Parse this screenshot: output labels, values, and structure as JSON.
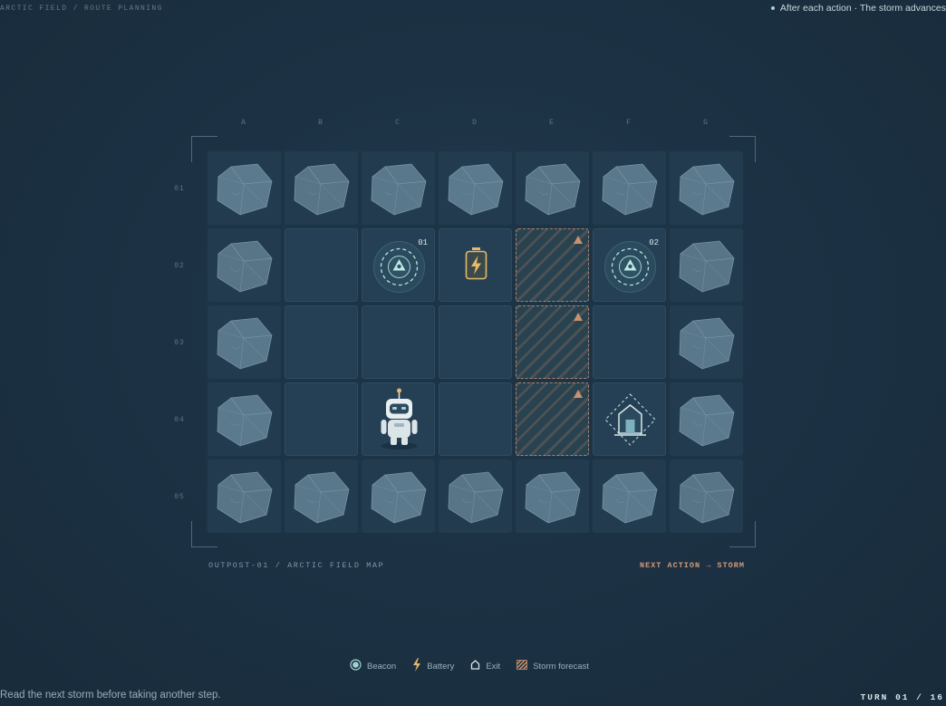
{
  "header": {
    "breadcrumb": "ARCTIC FIELD / ROUTE PLANNING",
    "status": "After each action · The storm advances"
  },
  "board": {
    "columns": [
      "A",
      "B",
      "C",
      "D",
      "E",
      "F",
      "G"
    ],
    "rows": [
      "01",
      "02",
      "03",
      "04",
      "05"
    ],
    "cells": [
      [
        "rock",
        "rock",
        "rock",
        "rock",
        "rock",
        "rock",
        "rock"
      ],
      [
        "rock",
        "empty",
        "beacon",
        "battery",
        "storm",
        "beacon",
        "rock"
      ],
      [
        "rock",
        "empty",
        "empty",
        "empty",
        "storm",
        "empty",
        "rock"
      ],
      [
        "rock",
        "empty",
        "robot",
        "empty",
        "storm",
        "exit",
        "rock"
      ],
      [
        "rock",
        "rock",
        "rock",
        "rock",
        "rock",
        "rock",
        "rock"
      ]
    ],
    "beacon_labels": {
      "C02": "01",
      "F02": "02"
    }
  },
  "captions": {
    "map_name": "OUTPOST-01 / ARCTIC FIELD MAP",
    "next_action": "NEXT ACTION → STORM"
  },
  "legend": {
    "beacon": "Beacon",
    "battery": "Battery",
    "exit": "Exit",
    "storm": "Storm forecast"
  },
  "footer": {
    "hint": "Read the next storm before taking another step.",
    "turn": "TURN 01 / 16"
  },
  "colors": {
    "accent_teal": "#9fd3d2",
    "storm_warning": "#c8916f",
    "battery": "#e6b86a"
  },
  "icons": {
    "beacon": "beacon-icon",
    "battery": "battery-icon",
    "exit": "exit-icon",
    "robot": "robot-icon",
    "rock": "rock-icon",
    "storm": "storm-warning-icon"
  }
}
